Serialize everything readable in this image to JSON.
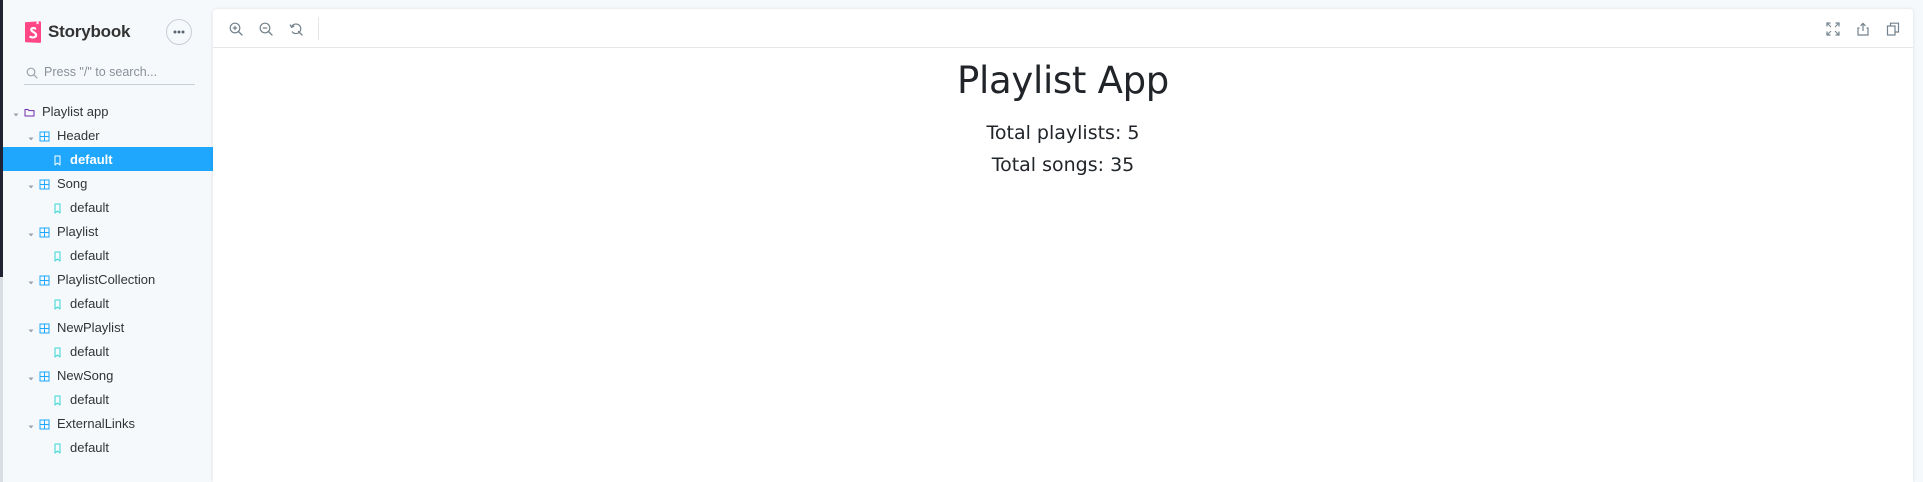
{
  "sidebar": {
    "brand": "Storybook",
    "search_placeholder": "Press \"/\" to search...",
    "tree": [
      {
        "label": "Playlist app",
        "level": 0,
        "kind": "folder",
        "expanded": true
      },
      {
        "label": "Header",
        "level": 1,
        "kind": "component",
        "expanded": true
      },
      {
        "label": "default",
        "level": 2,
        "kind": "story",
        "selected": true
      },
      {
        "label": "Song",
        "level": 1,
        "kind": "component",
        "expanded": true
      },
      {
        "label": "default",
        "level": 2,
        "kind": "story"
      },
      {
        "label": "Playlist",
        "level": 1,
        "kind": "component",
        "expanded": true
      },
      {
        "label": "default",
        "level": 2,
        "kind": "story"
      },
      {
        "label": "PlaylistCollection",
        "level": 1,
        "kind": "component",
        "expanded": true
      },
      {
        "label": "default",
        "level": 2,
        "kind": "story"
      },
      {
        "label": "NewPlaylist",
        "level": 1,
        "kind": "component",
        "expanded": true
      },
      {
        "label": "default",
        "level": 2,
        "kind": "story"
      },
      {
        "label": "NewSong",
        "level": 1,
        "kind": "component",
        "expanded": true
      },
      {
        "label": "default",
        "level": 2,
        "kind": "story"
      },
      {
        "label": "ExternalLinks",
        "level": 1,
        "kind": "component",
        "expanded": true
      },
      {
        "label": "default",
        "level": 2,
        "kind": "story"
      }
    ]
  },
  "toolbar": {
    "left_icons": [
      "zoom-in-icon",
      "zoom-out-icon",
      "zoom-reset-icon"
    ],
    "right_icons": [
      "fullscreen-icon",
      "share-icon",
      "copy-icon"
    ]
  },
  "preview": {
    "title": "Playlist App",
    "stats": [
      {
        "label": "Total playlists:",
        "value": "5"
      },
      {
        "label": "Total songs:",
        "value": "35"
      }
    ]
  },
  "colors": {
    "accent": "#1ea7fd",
    "brand_pink": "#ff4785",
    "folder_purple": "#6f2cac",
    "component_blue": "#1ea7fd",
    "story_teal": "#37d5d3",
    "sidebar_bg": "#f6f9fc"
  }
}
